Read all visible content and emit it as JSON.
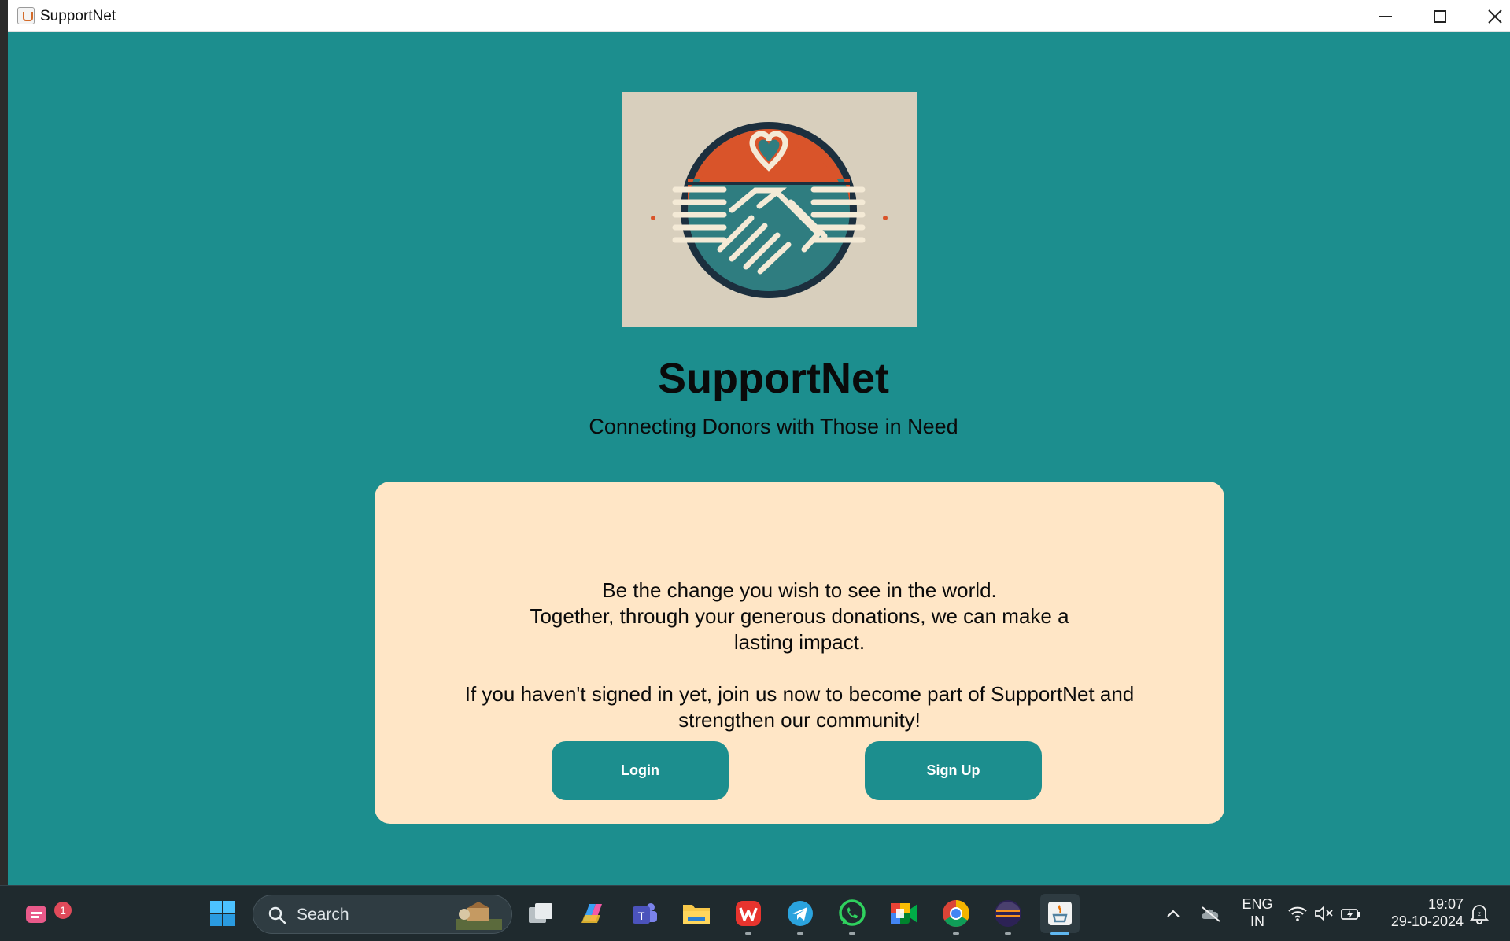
{
  "window": {
    "title": "SupportNet"
  },
  "header": {
    "app_name": "SupportNet",
    "tagline": "Connecting Donors with Those in Need"
  },
  "card": {
    "message_line1": "Be the change you wish to see in the world.",
    "message_line2": "Together, through your generous donations, we can make a lasting impact.",
    "invite": "If you haven't signed in yet, join us now to become part of SupportNet and strengthen our community!",
    "login_label": "Login",
    "signup_label": "Sign Up"
  },
  "taskbar": {
    "search_placeholder": "Search",
    "notification_count": "1",
    "language_line1": "ENG",
    "language_line2": "IN",
    "time": "19:07",
    "date": "29-10-2024",
    "pinned_apps": [
      "widgets",
      "start",
      "search",
      "task-view",
      "copilot",
      "teams",
      "file-explorer",
      "wps-office",
      "telegram",
      "whatsapp",
      "google-meet",
      "chrome",
      "eclipse",
      "java"
    ]
  },
  "colors": {
    "window_bg": "#1c8e8e",
    "card_bg": "#ffe6c6",
    "button_bg": "#1c8e8e",
    "logo_orange": "#d9542a",
    "logo_navy": "#1c2f3e",
    "logo_teal": "#2f7d80"
  }
}
